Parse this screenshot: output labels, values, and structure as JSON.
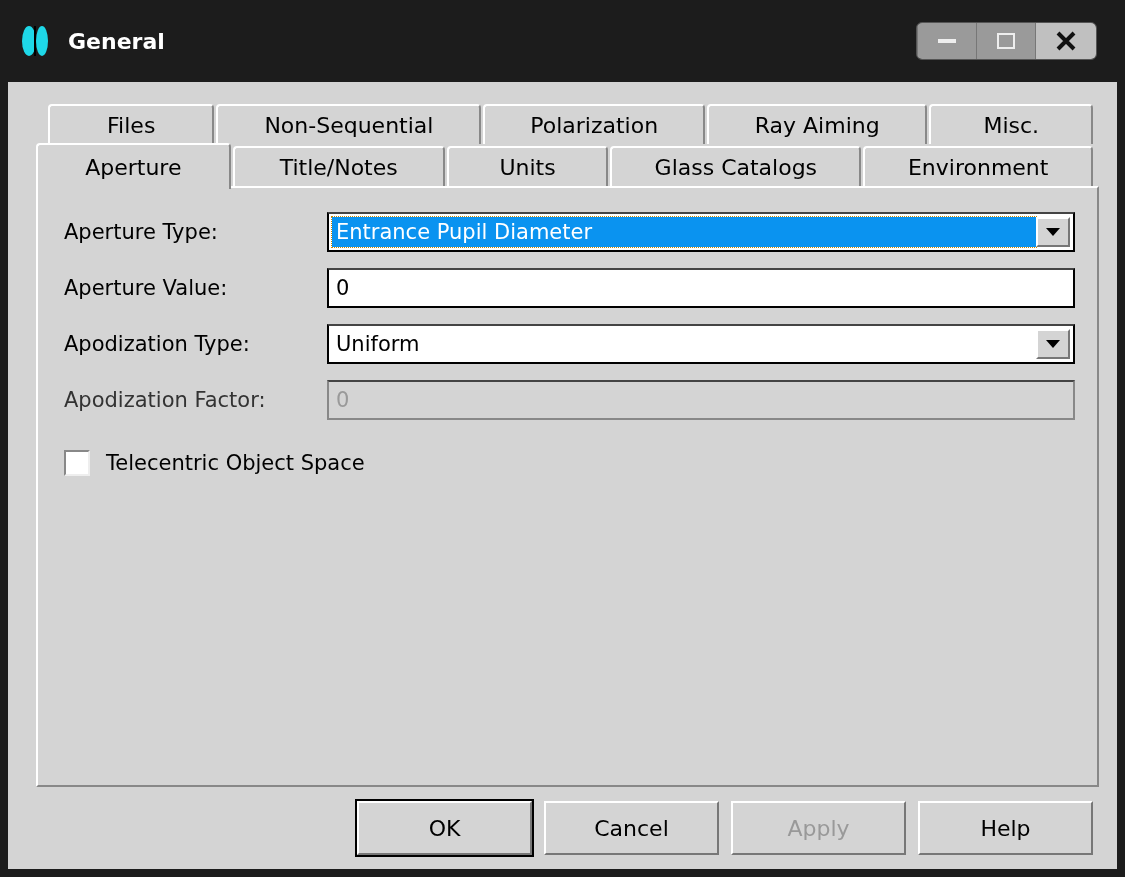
{
  "window": {
    "title": "General"
  },
  "tab_rows": [
    [
      {
        "label": "Files",
        "selected": false
      },
      {
        "label": "Non-Sequential",
        "selected": false
      },
      {
        "label": "Polarization",
        "selected": false
      },
      {
        "label": "Ray Aiming",
        "selected": false
      },
      {
        "label": "Misc.",
        "selected": false
      }
    ],
    [
      {
        "label": "Aperture",
        "selected": true
      },
      {
        "label": "Title/Notes",
        "selected": false
      },
      {
        "label": "Units",
        "selected": false
      },
      {
        "label": "Glass Catalogs",
        "selected": false
      },
      {
        "label": "Environment",
        "selected": false
      }
    ]
  ],
  "fields": [
    {
      "label": "Aperture Type:",
      "kind": "select",
      "value": "Entrance Pupil Diameter",
      "focused": true,
      "disabled": false
    },
    {
      "label": "Aperture Value:",
      "kind": "text",
      "value": "0",
      "focused": false,
      "disabled": false
    },
    {
      "label": "Apodization Type:",
      "kind": "select",
      "value": "Uniform",
      "focused": false,
      "disabled": false
    },
    {
      "label": "Apodization Factor:",
      "kind": "text",
      "value": "0",
      "focused": false,
      "disabled": true
    }
  ],
  "checkbox": {
    "label": "Telecentric Object Space",
    "checked": false
  },
  "buttons": [
    {
      "label": "OK",
      "default": true,
      "disabled": false
    },
    {
      "label": "Cancel",
      "default": false,
      "disabled": false
    },
    {
      "label": "Apply",
      "default": false,
      "disabled": true
    },
    {
      "label": "Help",
      "default": false,
      "disabled": false
    }
  ]
}
